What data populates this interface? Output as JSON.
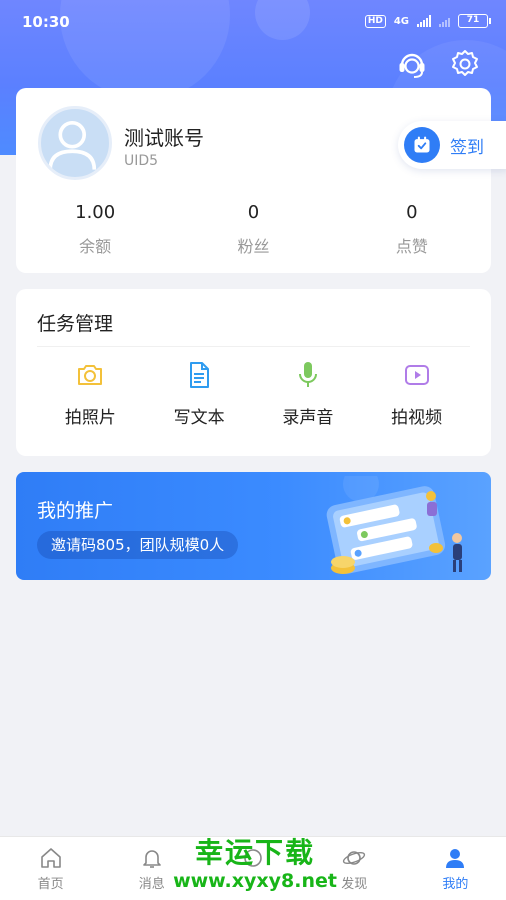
{
  "status_bar": {
    "time": "10:30",
    "network": "4G",
    "hd": "HD",
    "battery": "71"
  },
  "profile": {
    "username": "测试账号",
    "uid": "UID5",
    "checkin_label": "签到",
    "stats": [
      {
        "value": "1.00",
        "label": "余额"
      },
      {
        "value": "0",
        "label": "粉丝"
      },
      {
        "value": "0",
        "label": "点赞"
      }
    ]
  },
  "tasks": {
    "title": "任务管理",
    "items": [
      {
        "label": "拍照片",
        "icon": "camera-icon",
        "color": "#f3c13a"
      },
      {
        "label": "写文本",
        "icon": "document-icon",
        "color": "#2f9cf0"
      },
      {
        "label": "录声音",
        "icon": "microphone-icon",
        "color": "#7dc95e"
      },
      {
        "label": "拍视频",
        "icon": "video-icon",
        "color": "#b07ce8"
      }
    ]
  },
  "promo": {
    "title": "我的推广",
    "subtitle": "邀请码805，团队规模0人"
  },
  "tabbar": {
    "items": [
      {
        "label": "首页",
        "icon": "home-icon"
      },
      {
        "label": "消息",
        "icon": "bell-icon"
      },
      {
        "label": "",
        "icon": "center-icon"
      },
      {
        "label": "发现",
        "icon": "planet-icon"
      },
      {
        "label": "我的",
        "icon": "user-icon",
        "active": true
      }
    ]
  },
  "watermark": {
    "main": "幸运下载",
    "url": "www.xyxy8.net"
  },
  "colors": {
    "accent": "#2f7df6",
    "header": "#5b80ff",
    "watermark": "#18b518"
  }
}
